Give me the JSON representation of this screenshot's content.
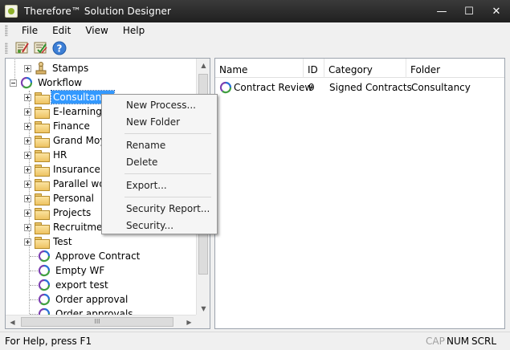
{
  "window": {
    "title": "Therefore™ Solution Designer",
    "minimize": "—",
    "maximize": "☐",
    "close": "✕"
  },
  "menu": [
    "File",
    "Edit",
    "View",
    "Help"
  ],
  "toolbar": {
    "icons": [
      "designer-icon",
      "designer-check-icon",
      "help-icon"
    ]
  },
  "tree": {
    "items": [
      {
        "label": "Stamps",
        "type": "stamps",
        "level": 1,
        "expander": "plus"
      },
      {
        "label": "Workflow",
        "type": "workflow",
        "level": 0,
        "expander": "minus"
      },
      {
        "label": "Consultancy",
        "type": "folder",
        "level": 1,
        "expander": "plus",
        "selected": true
      },
      {
        "label": "E-learning",
        "type": "folder",
        "level": 1,
        "expander": "plus"
      },
      {
        "label": "Finance",
        "type": "folder",
        "level": 1,
        "expander": "plus"
      },
      {
        "label": "Grand Moy",
        "type": "folder",
        "level": 1,
        "expander": "plus"
      },
      {
        "label": "HR",
        "type": "folder",
        "level": 1,
        "expander": "plus"
      },
      {
        "label": "Insurance",
        "type": "folder",
        "level": 1,
        "expander": "plus"
      },
      {
        "label": "Parallel wo",
        "type": "folder",
        "level": 1,
        "expander": "plus"
      },
      {
        "label": "Personal",
        "type": "folder",
        "level": 1,
        "expander": "plus"
      },
      {
        "label": "Projects",
        "type": "folder",
        "level": 1,
        "expander": "plus"
      },
      {
        "label": "Recruitmen",
        "type": "folder",
        "level": 1,
        "expander": "plus"
      },
      {
        "label": "Test",
        "type": "folder",
        "level": 1,
        "expander": "plus"
      },
      {
        "label": "Approve Contract",
        "type": "workflow",
        "level": 1,
        "expander": "none"
      },
      {
        "label": "Empty WF",
        "type": "workflow",
        "level": 1,
        "expander": "none"
      },
      {
        "label": "export test",
        "type": "workflow",
        "level": 1,
        "expander": "none"
      },
      {
        "label": "Order approval",
        "type": "workflow",
        "level": 1,
        "expander": "none"
      },
      {
        "label": "Order approvals",
        "type": "workflow",
        "level": 1,
        "expander": "none"
      }
    ],
    "hscroll_grip": "III"
  },
  "list": {
    "columns": [
      "Name",
      "ID",
      "Category",
      "Folder"
    ],
    "rows": [
      {
        "name": "Contract Review",
        "id": "9",
        "category": "Signed Contracts",
        "folder": "Consultancy"
      }
    ]
  },
  "context_menu": {
    "items": [
      "New Process...",
      "New Folder",
      "Rename",
      "Delete",
      "Export...",
      "Security Report...",
      "Security..."
    ]
  },
  "status": {
    "text": "For Help, press F1",
    "indicators": [
      {
        "label": "CAP",
        "active": false
      },
      {
        "label": "NUM",
        "active": true
      },
      {
        "label": "SCRL",
        "active": true
      }
    ]
  },
  "colors": {
    "selection": "#3399ff",
    "titlebar": "#2b2b2b",
    "folder": "#f0c862",
    "workflow_purple": "#7b3fb0",
    "workflow_green": "#40a040",
    "workflow_blue": "#2a6fd6"
  }
}
